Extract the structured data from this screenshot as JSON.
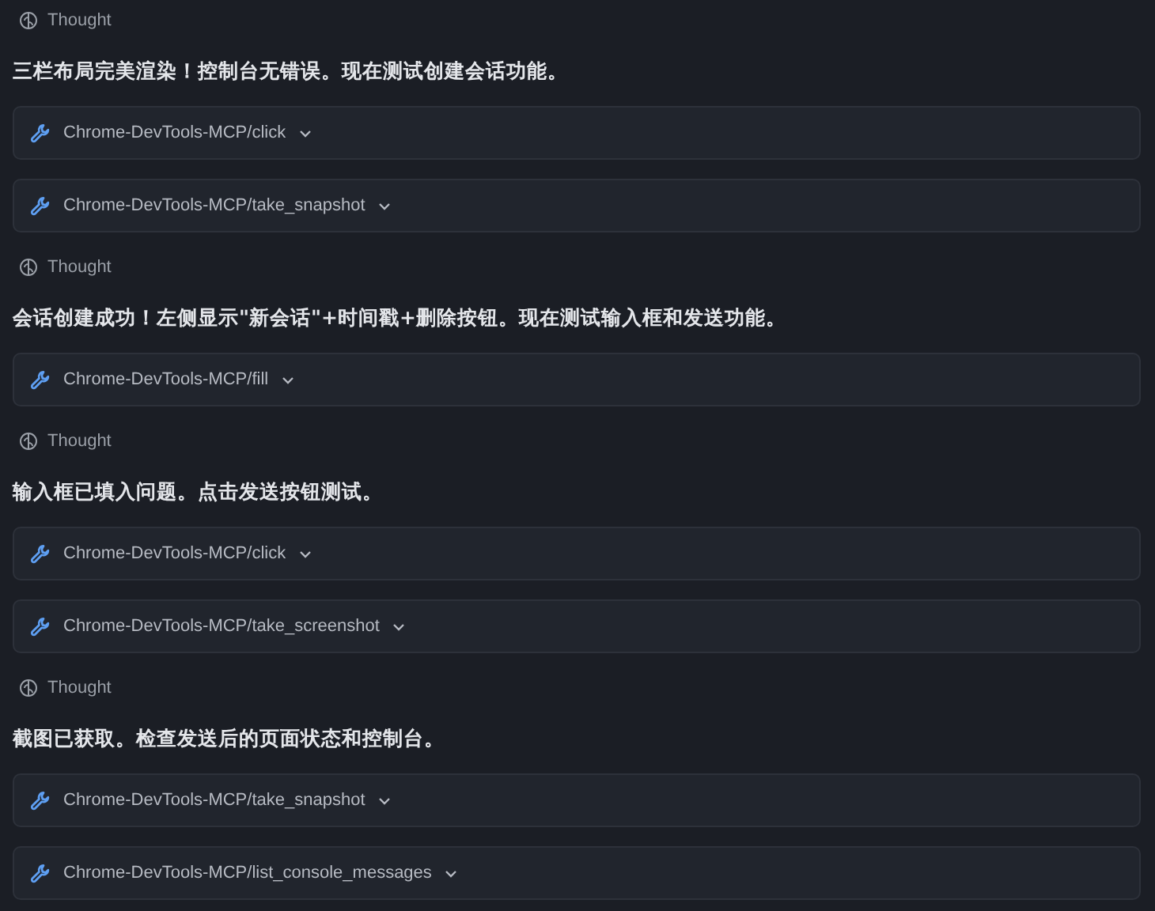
{
  "items": [
    {
      "kind": "thought",
      "label": "Thought"
    },
    {
      "kind": "message",
      "text": "三栏布局完美渲染！控制台无错误。现在测试创建会话功能。"
    },
    {
      "kind": "tool",
      "label": "Chrome-DevTools-MCP/click"
    },
    {
      "kind": "tool",
      "label": "Chrome-DevTools-MCP/take_snapshot"
    },
    {
      "kind": "thought",
      "label": "Thought"
    },
    {
      "kind": "message",
      "text": "会话创建成功！左侧显示\"新会话\"+时间戳+删除按钮。现在测试输入框和发送功能。"
    },
    {
      "kind": "tool",
      "label": "Chrome-DevTools-MCP/fill"
    },
    {
      "kind": "thought",
      "label": "Thought"
    },
    {
      "kind": "message",
      "text": "输入框已填入问题。点击发送按钮测试。"
    },
    {
      "kind": "tool",
      "label": "Chrome-DevTools-MCP/click"
    },
    {
      "kind": "tool",
      "label": "Chrome-DevTools-MCP/take_screenshot"
    },
    {
      "kind": "thought",
      "label": "Thought"
    },
    {
      "kind": "message",
      "text": "截图已获取。检查发送后的页面状态和控制台。"
    },
    {
      "kind": "tool",
      "label": "Chrome-DevTools-MCP/take_snapshot"
    },
    {
      "kind": "tool",
      "label": "Chrome-DevTools-MCP/list_console_messages"
    }
  ]
}
